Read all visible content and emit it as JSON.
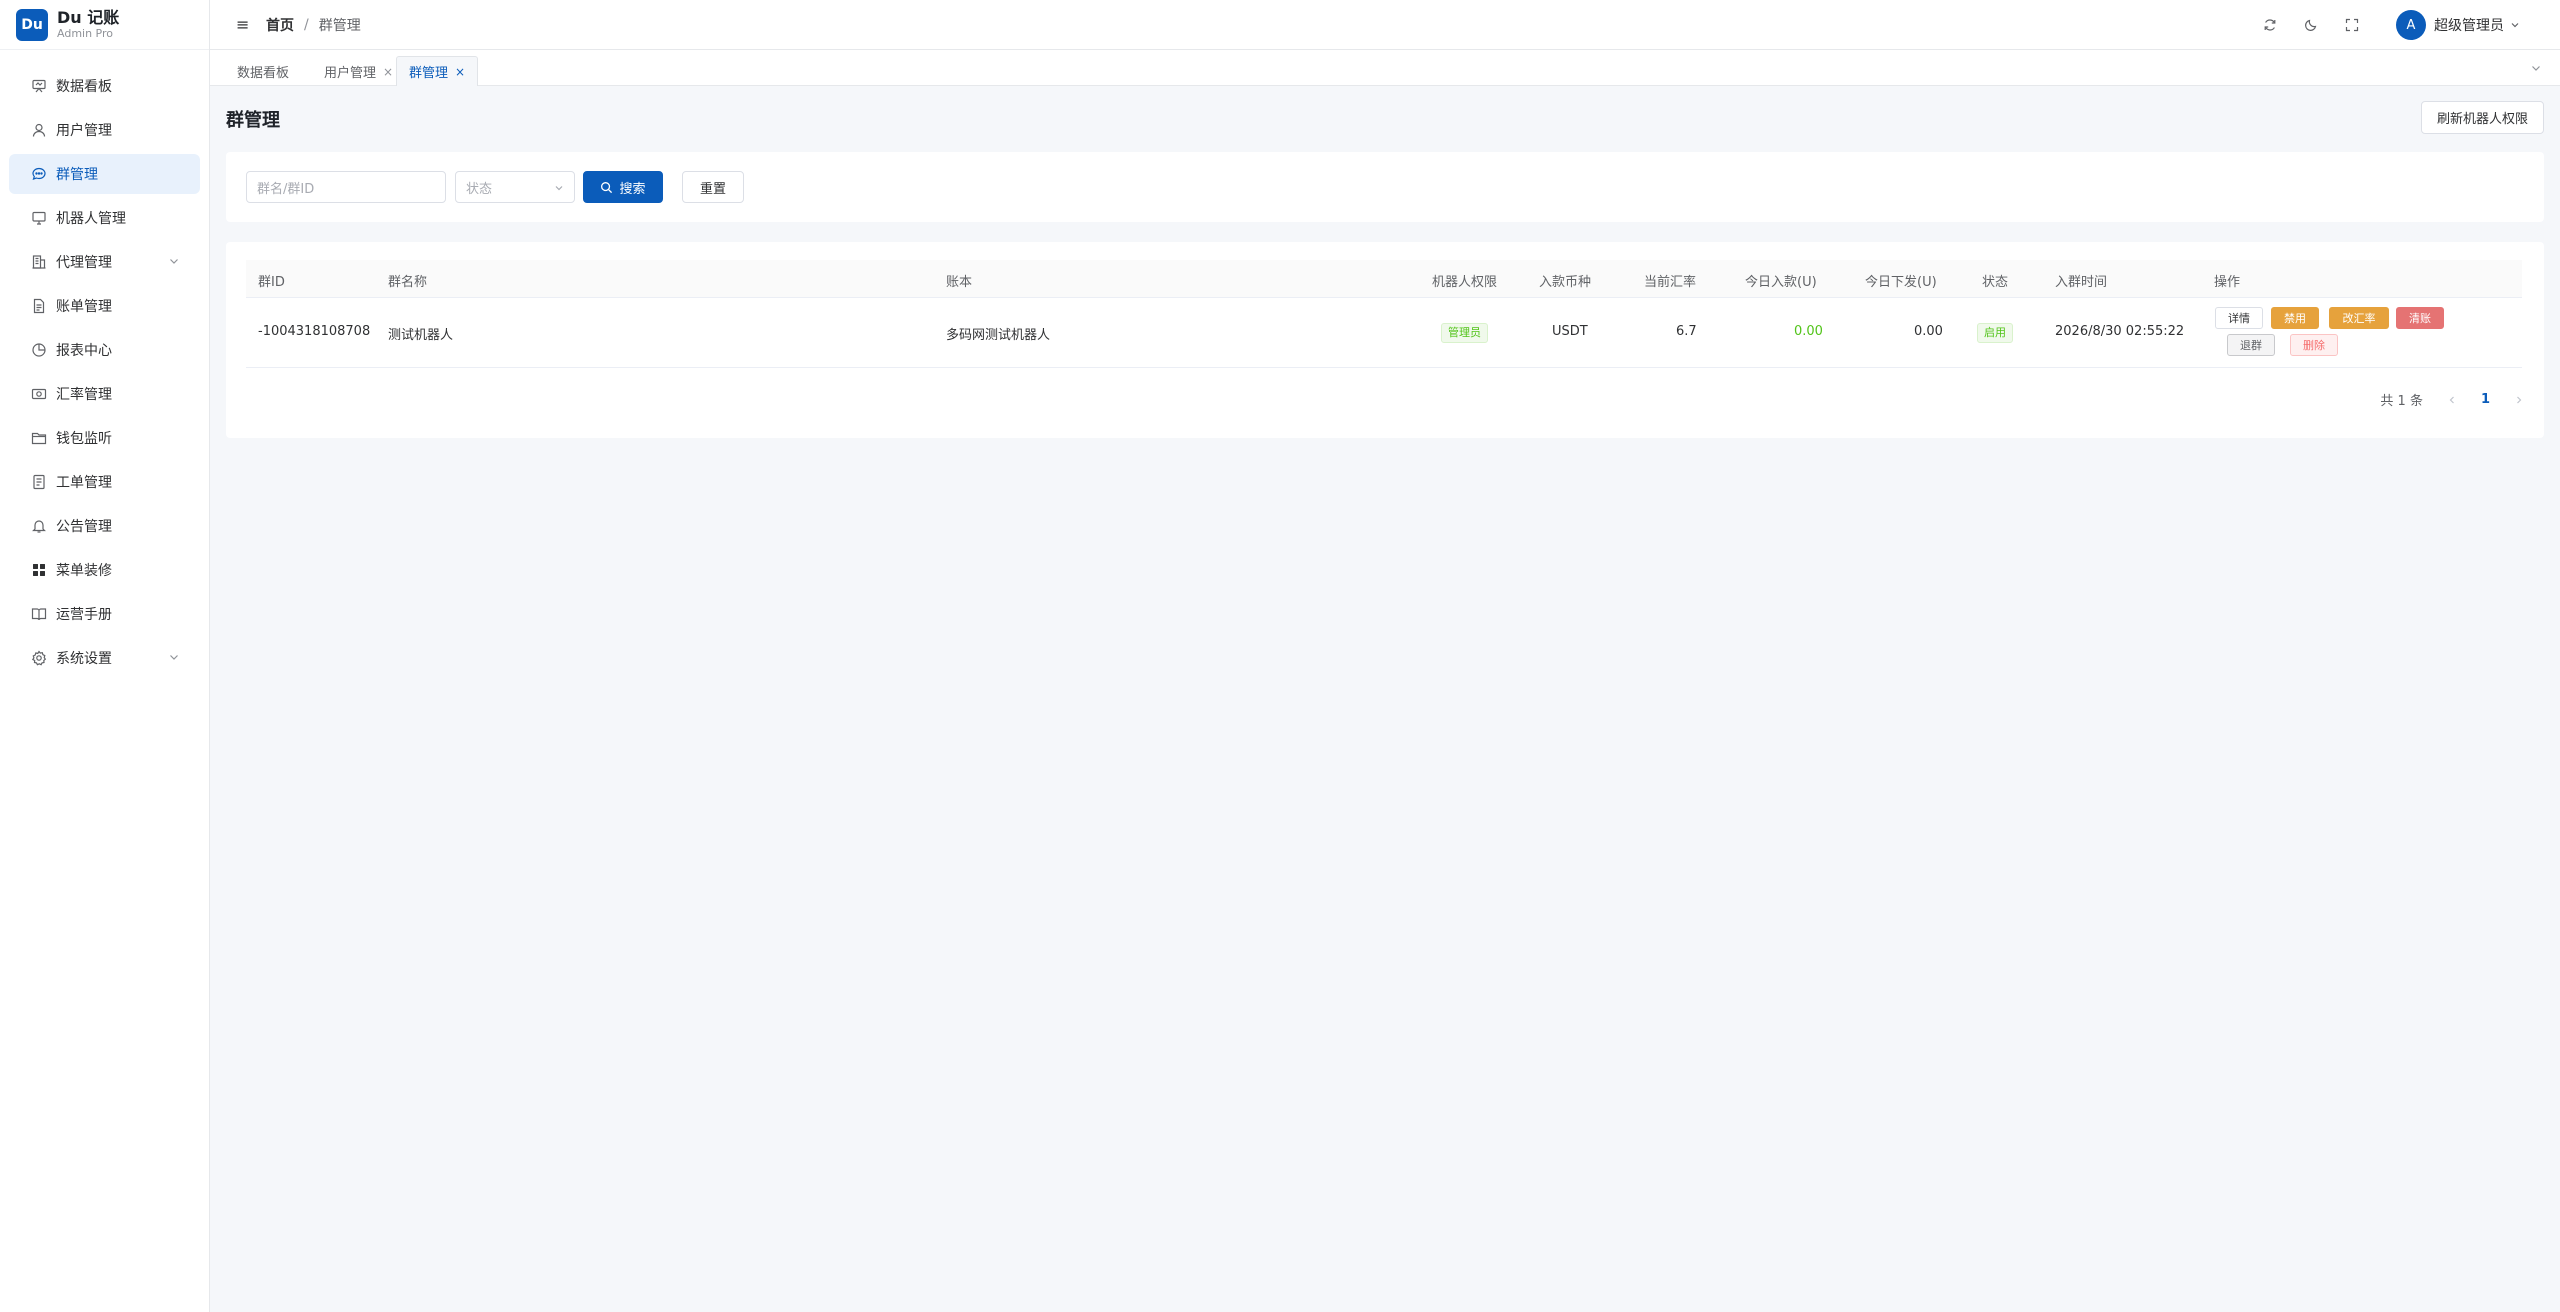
{
  "brand": {
    "logo": "Du",
    "title": "Du 记账",
    "subtitle": "Admin Pro"
  },
  "sidebar": {
    "items": [
      {
        "label": "数据看板",
        "icon": "presentation-board-icon"
      },
      {
        "label": "用户管理",
        "icon": "user-icon"
      },
      {
        "label": "群管理",
        "icon": "chat-icon",
        "active": true
      },
      {
        "label": "机器人管理",
        "icon": "monitor-icon"
      },
      {
        "label": "代理管理",
        "icon": "building-icon",
        "expandable": true
      },
      {
        "label": "账单管理",
        "icon": "document-icon"
      },
      {
        "label": "报表中心",
        "icon": "pie-chart-icon"
      },
      {
        "label": "汇率管理",
        "icon": "money-icon"
      },
      {
        "label": "钱包监听",
        "icon": "folder-icon"
      },
      {
        "label": "工单管理",
        "icon": "tickets-icon"
      },
      {
        "label": "公告管理",
        "icon": "bell-icon"
      },
      {
        "label": "菜单装修",
        "icon": "grid-icon"
      },
      {
        "label": "运营手册",
        "icon": "book-icon"
      },
      {
        "label": "系统设置",
        "icon": "gear-icon",
        "expandable": true
      }
    ]
  },
  "header": {
    "breadcrumb_home": "首页",
    "breadcrumb_sep": "/",
    "breadcrumb_current": "群管理",
    "avatar_letter": "A",
    "user_name": "超级管理员"
  },
  "tabs": [
    {
      "label": "数据看板",
      "closable": false
    },
    {
      "label": "用户管理",
      "closable": true
    },
    {
      "label": "群管理",
      "closable": true,
      "active": true
    }
  ],
  "page": {
    "title": "群管理",
    "refresh_label": "刷新机器人权限"
  },
  "search": {
    "name_placeholder": "群名/群ID",
    "status_placeholder": "状态",
    "search_label": "搜索",
    "reset_label": "重置"
  },
  "table": {
    "columns": [
      "群ID",
      "群名称",
      "账本",
      "机器人权限",
      "入款币种",
      "当前汇率",
      "今日入款(U)",
      "今日下发(U)",
      "状态",
      "入群时间",
      "操作"
    ],
    "rows": [
      {
        "group_id": "-1004318108708",
        "group_name": "测试机器人",
        "ledger": "多码网测试机器人",
        "bot_permission": "管理员",
        "currency": "USDT",
        "rate": "6.7",
        "today_in": "0.00",
        "today_out": "0.00",
        "status": "启用",
        "join_time": "2026/8/30 02:55:22",
        "actions": {
          "detail": "详情",
          "disable": "禁用",
          "change_rate": "改汇率",
          "clear": "清账",
          "leave": "退群",
          "delete": "删除"
        }
      }
    ]
  },
  "pager": {
    "total": "共 1 条",
    "current": "1"
  },
  "colors": {
    "primary": "#0b5cba",
    "success": "#52c41a",
    "warning": "#e6a23c",
    "danger": "#e57373"
  }
}
